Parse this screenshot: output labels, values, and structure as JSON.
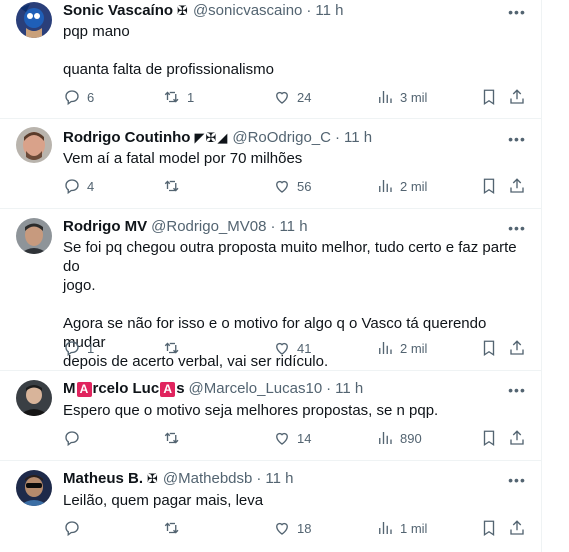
{
  "colors": {
    "text": "#0f1419",
    "muted": "#536471",
    "divider": "#eff3f4",
    "badge": "#e0245e"
  },
  "icons": {
    "reply": "reply-icon",
    "retweet": "retweet-icon",
    "like": "heart-icon",
    "views": "views-icon",
    "bookmark": "bookmark-icon",
    "share": "share-icon",
    "more": "more-icon"
  },
  "tweets": [
    {
      "name": "Sonic Vascaíno",
      "glyphs": "✠",
      "handle": "@sonicvascaino",
      "time": "11 h",
      "lines": [
        "pqp mano",
        "",
        "quanta falta de profissionalismo"
      ],
      "replies": "6",
      "retweets": "1",
      "likes": "24",
      "views": "3 mil"
    },
    {
      "name": "Rodrigo Coutinho",
      "glyphs": "◤✠◢",
      "handle": "@RoOdrigo_C",
      "time": "11 h",
      "lines": [
        "Vem aí a fatal model por 70 milhões"
      ],
      "replies": "4",
      "retweets": "",
      "likes": "56",
      "views": "2 mil"
    },
    {
      "name": "Rodrigo MV",
      "glyphs": "",
      "handle": "@Rodrigo_MV08",
      "time": "11 h",
      "lines": [
        "Se foi pq chegou outra proposta muito melhor, tudo certo e faz parte do",
        "jogo.",
        "",
        "Agora se não for isso e o motivo for algo q o Vasco tá querendo mudar",
        "depois de acerto verbal, vai ser ridículo."
      ],
      "replies": "1",
      "retweets": "",
      "likes": "41",
      "views": "2 mil"
    },
    {
      "name_parts": [
        "M",
        "A",
        "rcelo Luc",
        "A",
        "s"
      ],
      "handle": "@Marcelo_Lucas10",
      "time": "11 h",
      "lines": [
        "Espero que o motivo seja melhores propostas, se n pqp."
      ],
      "replies": "",
      "retweets": "",
      "likes": "14",
      "views": "890"
    },
    {
      "name": "Matheus B.",
      "glyphs": "✠",
      "handle": "@Mathebdsb",
      "time": "11 h",
      "lines": [
        "Leilão, quem pagar mais, leva"
      ],
      "replies": "",
      "retweets": "",
      "likes": "18",
      "views": "1 mil"
    }
  ]
}
